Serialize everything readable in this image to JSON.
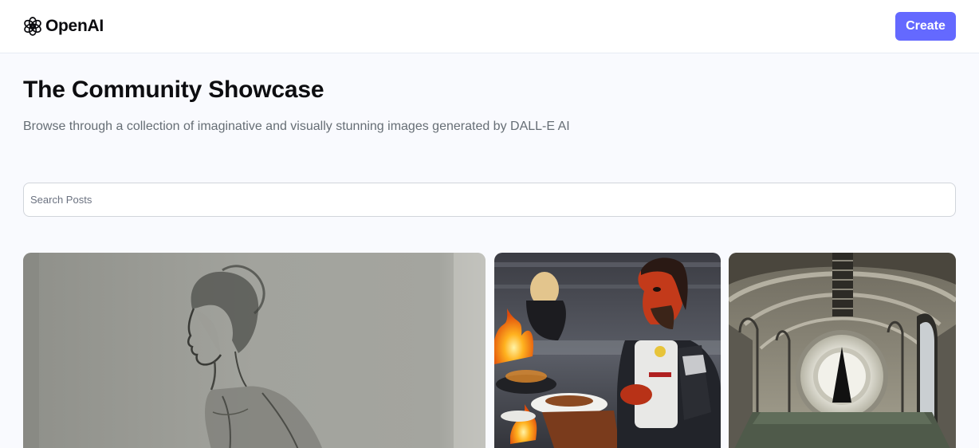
{
  "header": {
    "logo_text": "OpenAI",
    "create_label": "Create"
  },
  "main": {
    "title": "The Community Showcase",
    "subtitle": "Browse through a collection of imaginative and visually stunning images generated by DALL-E AI"
  },
  "search": {
    "placeholder": "Search Posts",
    "value": ""
  },
  "gallery": {
    "cards": [
      {
        "image": "pencil-sketch-woman-portrait"
      },
      {
        "image": "klingon-chef-grilling"
      },
      {
        "image": "arched-corridor-glowing-portal"
      }
    ]
  },
  "colors": {
    "accent": "#6469ff",
    "background": "#f9fafe",
    "title": "#222328",
    "subtitle": "#666e75"
  }
}
